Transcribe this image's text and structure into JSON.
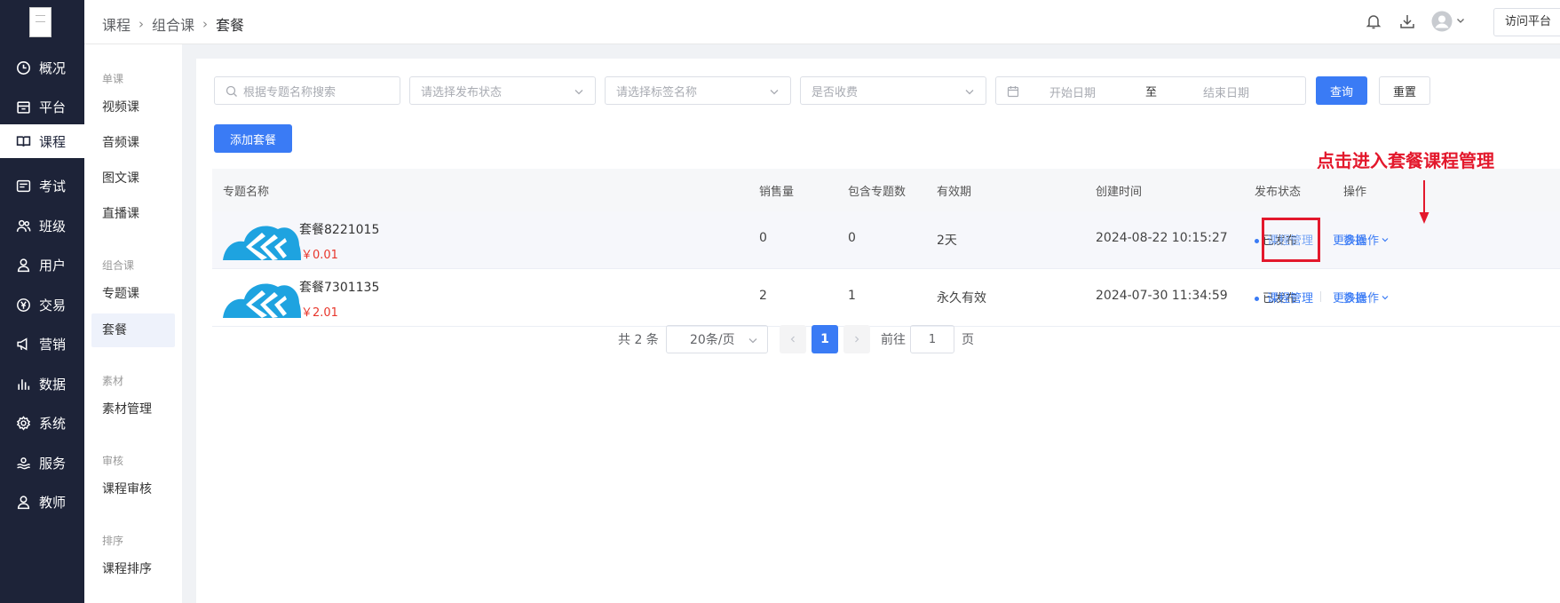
{
  "colors": {
    "sidebar_bg": "#1d2338",
    "primary": "#3a7bf5",
    "annotation": "#e3182c",
    "price": "#e8372c"
  },
  "sidebar": {
    "items": [
      {
        "label": "概况",
        "icon": "clock-icon"
      },
      {
        "label": "平台",
        "icon": "storefront-icon"
      },
      {
        "label": "课程",
        "icon": "book-icon",
        "active": true
      },
      {
        "label": "考试",
        "icon": "exam-icon"
      },
      {
        "label": "班级",
        "icon": "group-icon"
      },
      {
        "label": "用户",
        "icon": "user-icon"
      },
      {
        "label": "交易",
        "icon": "yen-icon"
      },
      {
        "label": "营销",
        "icon": "megaphone-icon"
      },
      {
        "label": "数据",
        "icon": "bar-chart-icon"
      },
      {
        "label": "系统",
        "icon": "gear-icon"
      },
      {
        "label": "服务",
        "icon": "service-icon"
      },
      {
        "label": "教师",
        "icon": "teacher-icon"
      }
    ]
  },
  "subnav": {
    "groups": [
      {
        "title": "单课",
        "items": [
          "视频课",
          "音频课",
          "图文课",
          "直播课"
        ]
      },
      {
        "title": "组合课",
        "items": [
          "专题课",
          "套餐"
        ]
      },
      {
        "title": "素材",
        "items": [
          "素材管理"
        ]
      },
      {
        "title": "审核",
        "items": [
          "课程审核"
        ]
      },
      {
        "title": "排序",
        "items": [
          "课程排序"
        ]
      }
    ],
    "active": "套餐"
  },
  "header": {
    "breadcrumb": [
      "课程",
      "组合课",
      "套餐"
    ],
    "visit_label": "访问平台"
  },
  "filters": {
    "search_placeholder": "根据专题名称搜索",
    "publish_status_placeholder": "请选择发布状态",
    "tag_placeholder": "请选择标签名称",
    "charge_placeholder": "是否收费",
    "start_date_placeholder": "开始日期",
    "date_separator": "至",
    "end_date_placeholder": "结束日期",
    "query_label": "查询",
    "reset_label": "重置"
  },
  "add_button_label": "添加套餐",
  "annotation": "点击进入套餐课程管理",
  "table": {
    "headers": [
      "专题名称",
      "销售量",
      "包含专题数",
      "有效期",
      "创建时间",
      "发布状态",
      "操作"
    ],
    "rows": [
      {
        "name": "套餐8221015",
        "price": "￥0.01",
        "sales": "0",
        "count": "0",
        "validity": "2天",
        "created": "2024-08-22 10:15:27",
        "status": "已发布",
        "op_data": "数据",
        "op_manage": "课程管理",
        "op_more": "更多操作"
      },
      {
        "name": "套餐7301135",
        "price": "￥2.01",
        "sales": "2",
        "count": "1",
        "validity": "永久有效",
        "created": "2024-07-30 11:34:59",
        "status": "已发布",
        "op_data": "数据",
        "op_manage": "课程管理",
        "op_more": "更多操作"
      }
    ]
  },
  "pagination": {
    "total": "共 2 条",
    "page_size": "20条/页",
    "current_page": "1",
    "goto_label": "前往",
    "goto_value": "1",
    "page_suffix": "页"
  }
}
